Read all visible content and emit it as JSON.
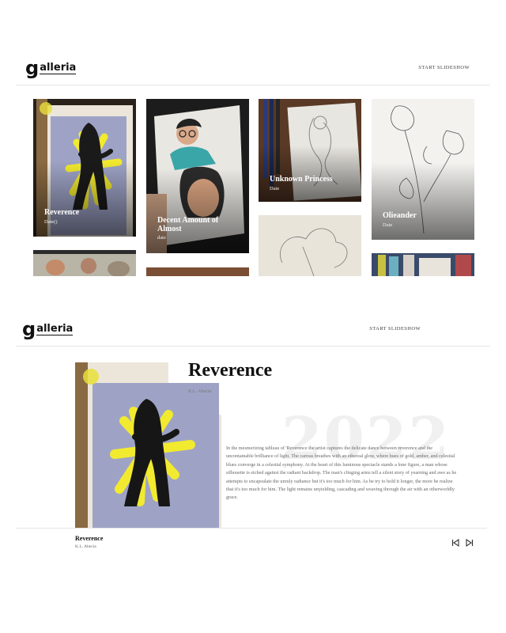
{
  "header": {
    "logo_g": "g",
    "logo_rest": "alleria",
    "slideshow_label": "START SLIDESHOW"
  },
  "gallery": {
    "cards": [
      {
        "title": "Reverence",
        "date": "Date()"
      },
      {
        "title": "Decent Amount of Almost",
        "date": "date"
      },
      {
        "title": "Unknown Princess",
        "date": "Date"
      },
      {
        "title": "Olieander",
        "date": "Date"
      }
    ]
  },
  "detail": {
    "title": "Reverence",
    "artist": "K.L. Abecia",
    "year": "2022",
    "description": "In the mesmerizing tableau of 'Reverence the artist captures the delicate dance between reverence and the uncontainable brilliance of light. The canvas breathes with an ethereal glow, where hues of gold, amber, and celestial blues converge in a celestial symphony. At the heart of this luminous spectacle stands a lone figure, a man whose silhouette is etched against the radiant backdrop. The man's clinging arms tell a silent story of yearning and awe as he attempts to encapsulate the unruly radiance but it's too much for him. As he try to hold it longer, the more he realize that it's too much for him. The light remains unyielding, cascading and weaving through the air with an otherworldly grace."
  },
  "footer": {
    "title": "Reverence",
    "artist": "K.L. Abecia"
  },
  "icons": {
    "prev": "previous-icon",
    "next": "next-icon"
  },
  "colors": {
    "accent_yellow": "#f2ea2f",
    "text_dark": "#111111"
  }
}
